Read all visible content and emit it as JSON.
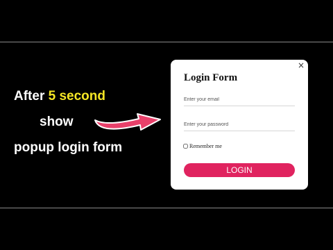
{
  "promo": {
    "line1_prefix": "After",
    "line1_highlight": "5 second",
    "line2": "show",
    "line3": "popup login form"
  },
  "modal": {
    "close_label": "×",
    "title": "Login Form",
    "email_placeholder": "Enter your email",
    "password_placeholder": "Enter your password",
    "remember_label": "Remember me",
    "login_label": "LOGIN"
  },
  "colors": {
    "background": "#000000",
    "highlight": "#f5e625",
    "accent": "#e0235f",
    "arrow": "#e8406a"
  }
}
